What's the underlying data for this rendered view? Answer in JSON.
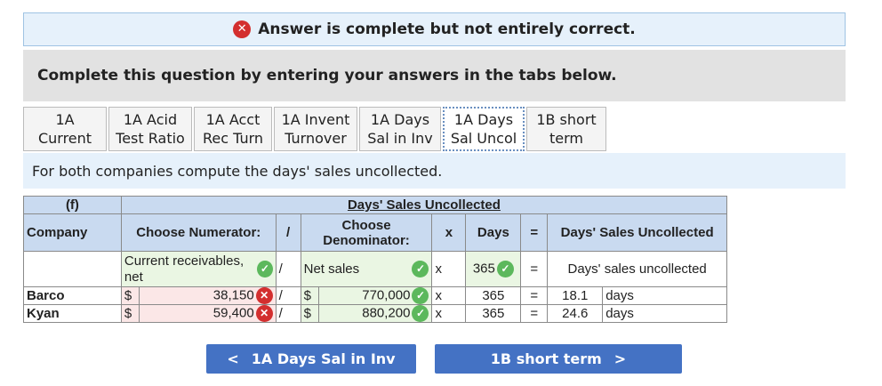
{
  "banner": {
    "text": "Answer is complete but not entirely correct."
  },
  "instruction": "Complete this question by entering your answers in the tabs below.",
  "tabs": [
    {
      "line1": "1A",
      "line2": "Current"
    },
    {
      "line1": "1A Acid",
      "line2": "Test Ratio"
    },
    {
      "line1": "1A Acct",
      "line2": "Rec Turn"
    },
    {
      "line1": "1A Invent",
      "line2": "Turnover"
    },
    {
      "line1": "1A Days",
      "line2": "Sal in Inv"
    },
    {
      "line1": "1A Days",
      "line2": "Sal Uncol"
    },
    {
      "line1": "1B short",
      "line2": "term"
    }
  ],
  "description": "For both companies compute the days' sales uncollected.",
  "table": {
    "f_label": "(f)",
    "title": "Days' Sales Uncollected",
    "company_header": "Company",
    "numerator_header": "Choose Numerator:",
    "slash": "/",
    "denominator_header": "Choose Denominator:",
    "x": "x",
    "days_header": "Days",
    "equals": "=",
    "result_header": "Days' Sales Uncollected",
    "formula_row": {
      "numerator": "Current receivables, net",
      "denominator": "Net sales",
      "days": "365",
      "result": "Days' sales uncollected"
    },
    "rows": [
      {
        "company": "Barco",
        "currency": "$",
        "numerator": "38,150",
        "denominator": "770,000",
        "days": "365",
        "result": "18.1",
        "unit": "days"
      },
      {
        "company": "Kyan",
        "currency": "$",
        "numerator": "59,400",
        "denominator": "880,200",
        "days": "365",
        "result": "24.6",
        "unit": "days"
      }
    ]
  },
  "nav": {
    "prev_label": "1A Days Sal in Inv",
    "next_label": "1B short term"
  }
}
